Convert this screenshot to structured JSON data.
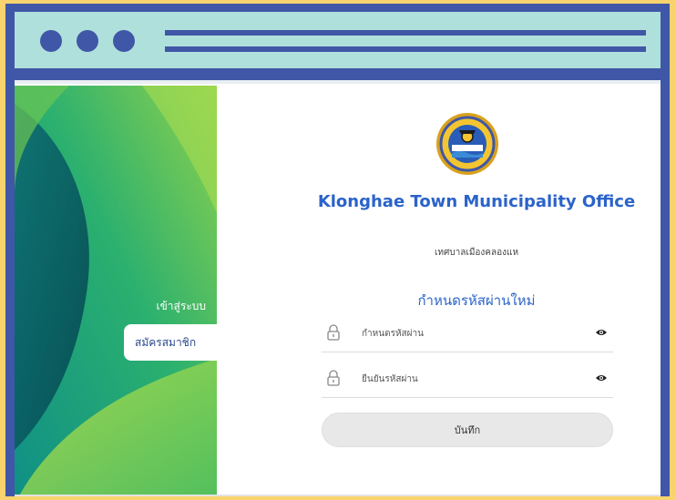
{
  "window": {
    "controls": [
      "dot",
      "dot",
      "dot"
    ]
  },
  "app": {
    "title": "Klonghae Town Municipality Office",
    "subtitle": "เทศบาลเมืองคลองแห",
    "logo_icon": "municipality-seal-icon"
  },
  "sidebar": {
    "items": [
      {
        "label": "เข้าสู่ระบบ"
      },
      {
        "label": "สมัครสมาชิก"
      }
    ]
  },
  "form": {
    "heading": "กำหนดรหัสผ่านใหม่",
    "fields": [
      {
        "placeholder": "กำหนดรหัสผ่าน",
        "icon": "lock-icon",
        "toggle_icon": "eye-icon"
      },
      {
        "placeholder": "ยืนยันรหัสผ่าน",
        "icon": "lock-icon",
        "toggle_icon": "eye-icon"
      }
    ],
    "save_label": "บันทึก"
  },
  "colors": {
    "background": "#f9d46e",
    "frame": "#3f57a6",
    "titlebar": "#b0e0dc",
    "accent": "#2b63c9"
  }
}
